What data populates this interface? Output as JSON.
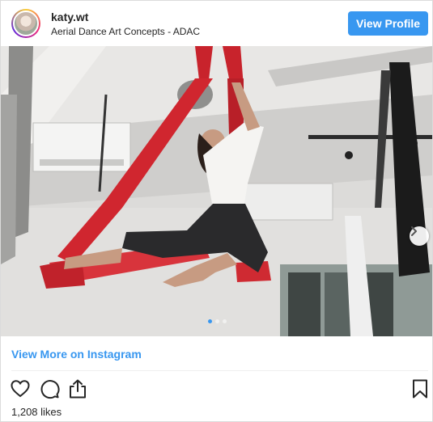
{
  "header": {
    "username": "katy.wt",
    "subtitle": "Aerial Dance Art Concepts - ADAC",
    "view_profile_label": "View Profile"
  },
  "photo": {
    "slide_count": 3,
    "active_slide": 1,
    "next_icon": "chevron-right-icon"
  },
  "footer": {
    "view_more_label": "View More on Instagram",
    "likes_text": "1,208 likes"
  },
  "icons": {
    "like": "heart-icon",
    "comment": "comment-icon",
    "share": "share-icon",
    "save": "bookmark-icon"
  },
  "colors": {
    "accent": "#3897f0",
    "silk": "#d0262f",
    "border": "#dbdbdb"
  }
}
